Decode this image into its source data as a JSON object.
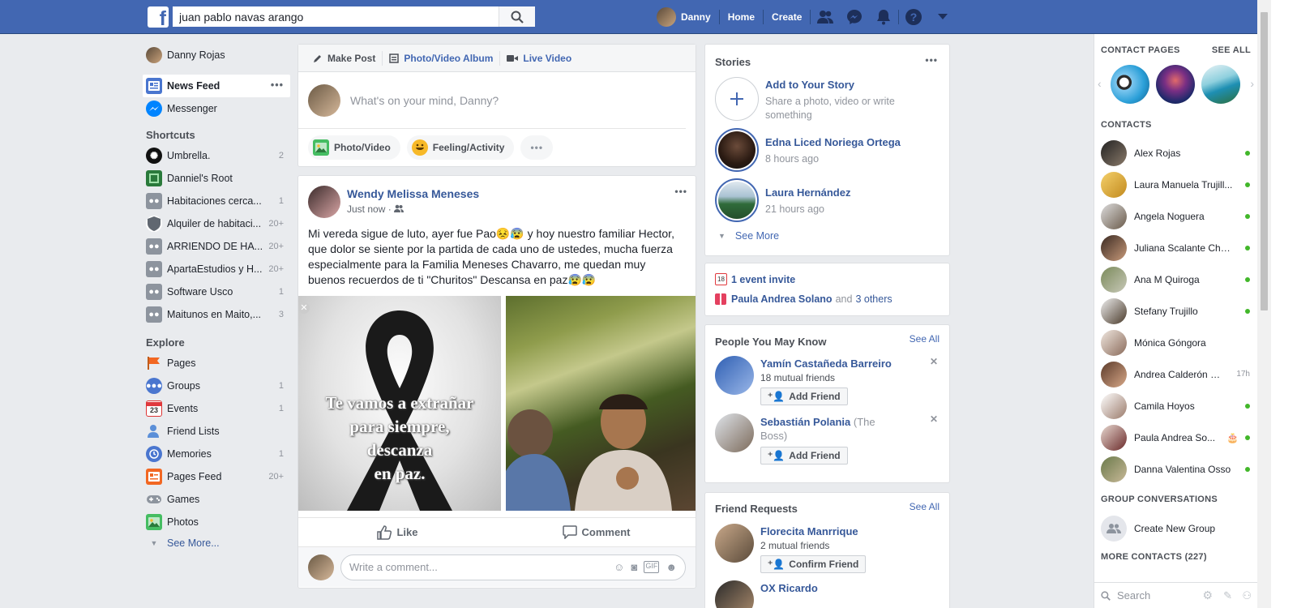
{
  "topbar": {
    "logo": "f",
    "search_value": "juan pablo navas arango",
    "profile_name": "Danny",
    "home": "Home",
    "create": "Create"
  },
  "left": {
    "profile": "Danny Rojas",
    "news_feed": "News Feed",
    "messenger": "Messenger",
    "shortcuts_title": "Shortcuts",
    "shortcuts": [
      {
        "label": "Umbrella.  ",
        "count": "2"
      },
      {
        "label": "Danniel's Root",
        "count": ""
      },
      {
        "label": "Habitaciones cerca...",
        "count": "1"
      },
      {
        "label": "Alquiler de habitaci...",
        "count": "20+"
      },
      {
        "label": "ARRIENDO DE HA...",
        "count": "20+"
      },
      {
        "label": "ApartaEstudios y H...",
        "count": "20+"
      },
      {
        "label": "Software Usco",
        "count": "1"
      },
      {
        "label": "Maitunos en Maito,...",
        "count": "3"
      }
    ],
    "explore_title": "Explore",
    "explore": [
      {
        "label": "Pages",
        "count": ""
      },
      {
        "label": "Groups",
        "count": "1"
      },
      {
        "label": "Events",
        "count": "1"
      },
      {
        "label": "Friend Lists",
        "count": ""
      },
      {
        "label": "Memories",
        "count": "1"
      },
      {
        "label": "Pages Feed",
        "count": "20+"
      },
      {
        "label": "Games",
        "count": ""
      },
      {
        "label": "Photos",
        "count": ""
      }
    ],
    "see_more": "See More..."
  },
  "composer": {
    "tab_make_post": "Make Post",
    "tab_album": "Photo/Video Album",
    "tab_live": "Live Video",
    "placeholder": "What's on your mind, Danny?",
    "action_photo": "Photo/Video",
    "action_feeling": "Feeling/Activity"
  },
  "post": {
    "author": "Wendy Melissa Meneses",
    "time": "Just now ·",
    "text": "Mi vereda sigue de luto, ayer fue Pao😣😰 y hoy nuestro familiar Hector, que dolor se siente por la partida de cada uno de ustedes, mucha fuerza especialmente para la Familia Meneses Chavarro, me quedan muy buenos recuerdos de ti \"Churitos\" Descansa en paz😰😰",
    "image_text": [
      "Te vamos a extrañar",
      "para siempre,",
      "descanza",
      "en paz."
    ],
    "like": "Like",
    "comment": "Comment",
    "comment_placeholder": "Write a comment..."
  },
  "stories": {
    "title": "Stories",
    "add_title": "Add to Your Story",
    "add_sub": "Share a photo, video or write something",
    "items": [
      {
        "name": "Edna Liced Noriega Ortega",
        "time": "8 hours ago"
      },
      {
        "name": "Laura Hernández",
        "time": "21 hours ago"
      }
    ],
    "see_more": "See More"
  },
  "events": {
    "invite": "1 event invite",
    "birthday_name": "Paula Andrea Solano",
    "birthday_and": "and",
    "birthday_others": "3 others",
    "calendar_day": "18"
  },
  "pymk": {
    "title": "People You May Know",
    "see_all": "See All",
    "people": [
      {
        "name": "Yamín Castañeda Barreiro",
        "extra": "",
        "sub": "18 mutual friends",
        "button": "Add Friend"
      },
      {
        "name": "Sebastián Polania",
        "extra": "(The Boss)",
        "sub": "",
        "button": "Add Friend"
      }
    ]
  },
  "friend_requests": {
    "title": "Friend Requests",
    "see_all": "See All",
    "people": [
      {
        "name": "Florecita Manrrique",
        "sub": "2 mutual friends",
        "button": "Confirm Friend"
      },
      {
        "name": "OX Ricardo",
        "sub": "",
        "button": ""
      }
    ]
  },
  "chat": {
    "contact_pages_title": "CONTACT PAGES",
    "see_all": "SEE ALL",
    "contacts_title": "CONTACTS",
    "contacts": [
      {
        "name": "Alex Rojas",
        "status": "online"
      },
      {
        "name": "Laura Manuela Trujill...",
        "status": "online"
      },
      {
        "name": "Angela Noguera",
        "status": "online"
      },
      {
        "name": "Juliana Scalante Cha...",
        "status": "online"
      },
      {
        "name": "Ana M Quiroga",
        "status": "online"
      },
      {
        "name": "Stefany Trujillo",
        "status": "online"
      },
      {
        "name": "Mónica Góngora",
        "status": ""
      },
      {
        "name": "Andrea Calderón S...",
        "status": "17h"
      },
      {
        "name": "Camila Hoyos",
        "status": "online"
      },
      {
        "name": "Paula Andrea So...",
        "status": "online"
      },
      {
        "name": "Danna Valentina Osso",
        "status": "online"
      }
    ],
    "group_conv_title": "GROUP CONVERSATIONS",
    "create_group": "Create New Group",
    "more_contacts": "MORE CONTACTS (227)",
    "search_placeholder": "Search"
  },
  "colors": {
    "brand_blue": "#4267b2",
    "link_blue": "#365899",
    "online_green": "#42b72a",
    "page_bg": "#e9ebee"
  }
}
